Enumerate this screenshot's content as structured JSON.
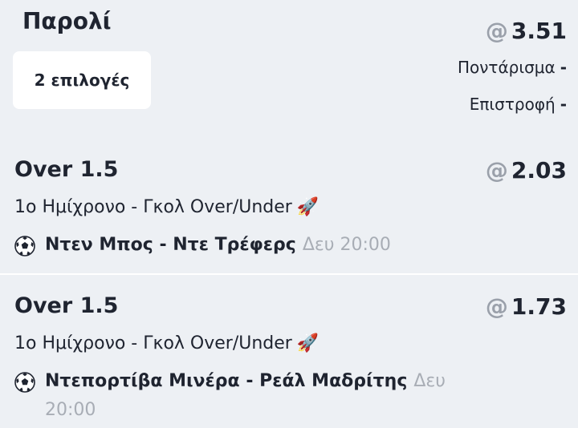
{
  "bet": {
    "type_label": "Παρολί",
    "selections_label": "2 επιλογές",
    "total_odds": "3.51",
    "at_symbol": "@",
    "stake_label": "Ποντάρισμα",
    "stake_value": "-",
    "return_label": "Επιστροφή",
    "return_value": "-"
  },
  "selections": [
    {
      "market": "Over 1.5",
      "odds": "2.03",
      "description": "1ο Ημίχρονο - Γκολ Over/Under",
      "icon": "rocket-icon",
      "sport_icon": "soccer-ball-icon",
      "teams": "Ντεν Μπος - Ντε Τρέφερς",
      "kickoff": "Δευ 20:00"
    },
    {
      "market": "Over 1.5",
      "odds": "1.73",
      "description": "1ο Ημίχρονο - Γκολ Over/Under",
      "icon": "rocket-icon",
      "sport_icon": "soccer-ball-icon",
      "teams": "Ντεπορτίβα Μινέρα - Ρεάλ Μαδρίτης",
      "kickoff": "Δευ 20:00"
    }
  ]
}
